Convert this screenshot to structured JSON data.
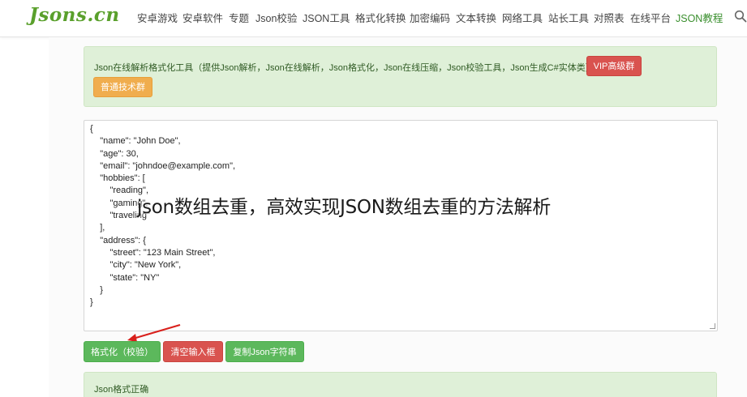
{
  "header": {
    "logo": "Jsons.cn",
    "nav": [
      "安卓游戏",
      "安卓软件",
      "专题",
      "Json校验",
      "JSON工具",
      "格式化转换",
      "加密编码",
      "文本转换",
      "网络工具",
      "站长工具",
      "对照表",
      "在线平台",
      "JSON教程"
    ],
    "active_nav": "JSON教程",
    "search_icon": "search-icon"
  },
  "alert": {
    "text": "Json在线解析格式化工具（提供Json解析，Json在线解析，Json格式化，Json在线压缩，Json校验工具，Json生成C#实体类）",
    "vip_label": "VIP高级群",
    "group_label": "普通技术群"
  },
  "editor": {
    "lines": [
      "{",
      "    \"name\": \"John Doe\",",
      "    \"age\": 30,",
      "    \"email\": \"johndoe@example.com\",",
      "    \"hobbies\": [",
      "        \"reading\",",
      "        \"gaming\",",
      "        \"traveling\"",
      "    ],",
      "    \"address\": {",
      "        \"street\": \"123 Main Street\",",
      "        \"city\": \"New York\",",
      "        \"state\": \"NY\"",
      "    }",
      "}"
    ]
  },
  "overlay_title": "json数组去重，高效实现JSON数组去重的方法解析",
  "actions": {
    "format_label": "格式化（校验）",
    "clear_label": "清空输入框",
    "copy_label": "复制Json字符串"
  },
  "result": {
    "text": "Json格式正确"
  },
  "colors": {
    "brand_green": "#5aa02c",
    "success_bg": "#dff0d8",
    "btn_green": "#5cb85c",
    "btn_red": "#d9534f",
    "btn_orange": "#f0ad4e",
    "arrow_red": "#d9201c"
  }
}
